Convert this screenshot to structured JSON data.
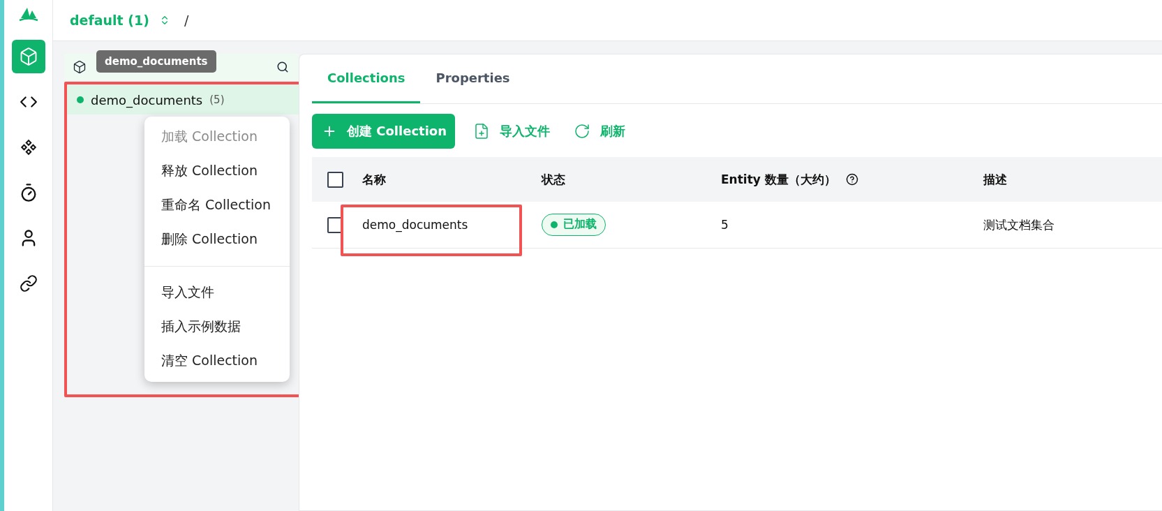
{
  "rail": [
    {
      "kind": "cube",
      "selected": true
    },
    {
      "kind": "code",
      "selected": false
    },
    {
      "kind": "diamonds",
      "selected": false
    },
    {
      "kind": "timer",
      "selected": false
    },
    {
      "kind": "user",
      "selected": false
    },
    {
      "kind": "link",
      "selected": false
    }
  ],
  "breadcrumb": {
    "database": "default (1)",
    "separator": "/"
  },
  "sidebar": {
    "tooltip": "demo_documents",
    "highlighted": true,
    "items": [
      {
        "name": "demo_documents",
        "count": "(5)",
        "selected": true
      }
    ]
  },
  "context_menu": [
    {
      "kind": "item",
      "label": "加载 Collection",
      "disabled": true
    },
    {
      "kind": "item",
      "label": "释放 Collection",
      "disabled": false
    },
    {
      "kind": "item",
      "label": "重命名 Collection",
      "disabled": false
    },
    {
      "kind": "item",
      "label": "删除 Collection",
      "disabled": false
    },
    {
      "kind": "divider"
    },
    {
      "kind": "item",
      "label": "导入文件",
      "disabled": false
    },
    {
      "kind": "item",
      "label": "插入示例数据",
      "disabled": false
    },
    {
      "kind": "item",
      "label": "清空 Collection",
      "disabled": false
    }
  ],
  "tabs": [
    {
      "label": "Collections",
      "selected": true
    },
    {
      "label": "Properties",
      "selected": false
    }
  ],
  "toolbar": [
    {
      "kind": "create",
      "label": "创建 Collection"
    },
    {
      "kind": "import",
      "label": "导入文件"
    },
    {
      "kind": "refresh",
      "label": "刷新"
    }
  ],
  "table": {
    "all_checked": false,
    "columns": [
      {
        "label": "名称",
        "help": false
      },
      {
        "label": "状态",
        "help": false
      },
      {
        "label": "Entity 数量（大约）",
        "help": true
      },
      {
        "label": "描述",
        "help": false
      }
    ],
    "rows": [
      {
        "name": "demo_documents",
        "highlighted": true,
        "status": "已加载",
        "loaded": true,
        "count": "5",
        "description": "测试文档集合",
        "checked": false
      }
    ]
  }
}
